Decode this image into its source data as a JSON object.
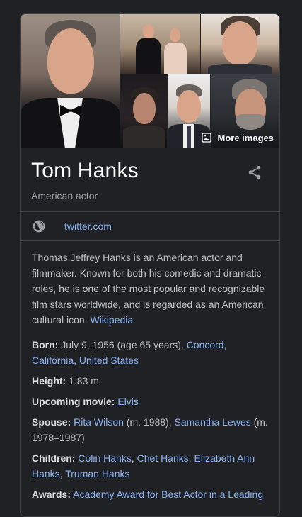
{
  "gallery": {
    "more_images_label": "More images"
  },
  "header": {
    "name": "Tom Hanks",
    "subtitle": "American actor"
  },
  "website": {
    "label": "twitter.com"
  },
  "description": {
    "text": "Thomas Jeffrey Hanks is an American actor and filmmaker. Known for both his comedic and dramatic roles, he is one of the most popular and recognizable film stars worldwide, and is regarded as an American cultural icon. ",
    "source": "Wikipedia"
  },
  "facts": {
    "born": {
      "label": "Born:",
      "text": " July 9, 1956 (age 65 years), ",
      "link1": "Concord,",
      "link2": "California",
      "sep": ", ",
      "link3": "United States"
    },
    "height": {
      "label": "Height:",
      "text": " 1.83 m"
    },
    "upcoming": {
      "label": "Upcoming movie:",
      "link": "Elvis"
    },
    "spouse": {
      "label": "Spouse:",
      "link1": "Rita Wilson",
      "text1": " (m. 1988), ",
      "link2": "Samantha Lewes",
      "text2": " (m. 1978–1987)"
    },
    "children": {
      "label": "Children:",
      "link1": "Colin Hanks",
      "link2": "Chet Hanks",
      "link3": "Elizabeth Ann Hanks",
      "link4": "Truman Hanks",
      "sep": ", "
    },
    "awards": {
      "label": "Awards:",
      "link": "Academy Award for Best Actor in a Leading"
    }
  }
}
